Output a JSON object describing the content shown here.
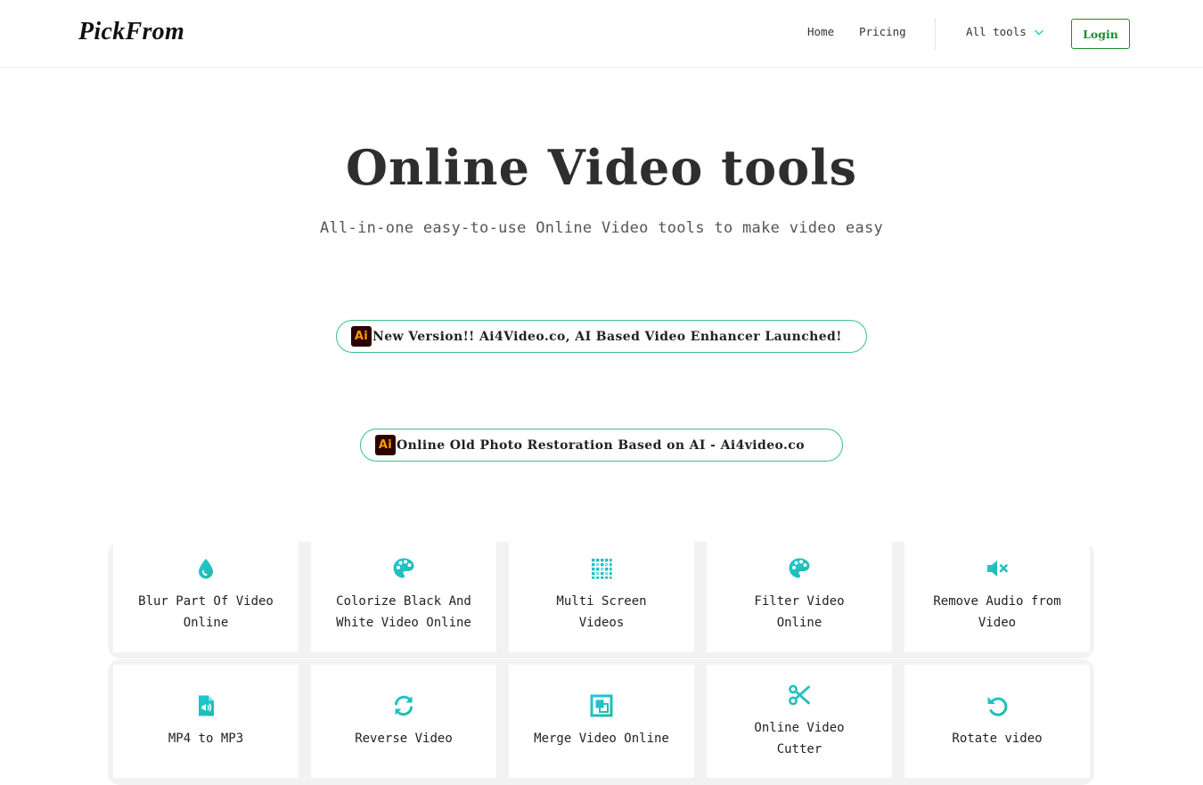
{
  "header": {
    "logo": "PickFrom",
    "nav": {
      "home": "Home",
      "pricing": "Pricing",
      "all_tools": "All tools"
    },
    "login_label": "Login"
  },
  "hero": {
    "title": "Online Video tools",
    "subtitle": "All-in-one easy-to-use Online Video tools to make video easy"
  },
  "promos": [
    {
      "badge": "Ai",
      "text": "New Version!! Ai4Video.co, AI Based Video Enhancer Launched!"
    },
    {
      "badge": "Ai",
      "text": "Online Old Photo Restoration Based on AI - Ai4video.co"
    }
  ],
  "tools": [
    {
      "label": "Blur Part Of Video Online",
      "icon": "drop-icon"
    },
    {
      "label": "Colorize Black And White Video Online",
      "icon": "palette-icon"
    },
    {
      "label": "Multi Screen Videos",
      "icon": "grid-dots-icon"
    },
    {
      "label": "Filter Video Online",
      "icon": "palette-icon"
    },
    {
      "label": "Remove Audio from Video",
      "icon": "mute-icon"
    },
    {
      "label": "MP4 to MP3",
      "icon": "audio-file-icon"
    },
    {
      "label": "Reverse Video",
      "icon": "refresh-icon"
    },
    {
      "label": "Merge Video Online",
      "icon": "merge-icon"
    },
    {
      "label": "Online Video Cutter",
      "icon": "scissors-icon"
    },
    {
      "label": "Rotate video",
      "icon": "rotate-icon"
    }
  ],
  "colors": {
    "accent_green": "#1e8a2e",
    "promo_border": "#3cc08b",
    "icon_gradient_start": "#1ec8d8",
    "icon_gradient_end": "#24b7a6"
  }
}
